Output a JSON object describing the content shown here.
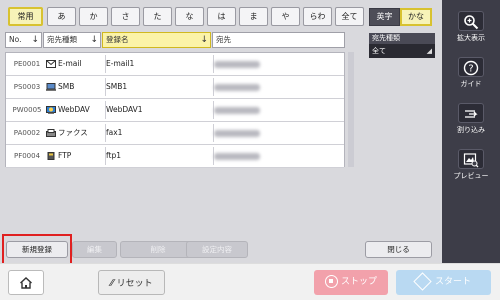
{
  "index_tabs": [
    "常用",
    "あ",
    "か",
    "さ",
    "た",
    "な",
    "は",
    "ま",
    "や",
    "らわ",
    "全て"
  ],
  "char_toggle": {
    "alpha": "英字",
    "kana": "かな"
  },
  "headers": {
    "no": "No.",
    "type": "宛先種類",
    "name": "登録名",
    "dest": "宛先"
  },
  "filter": {
    "label": "宛先種類",
    "value": "全て"
  },
  "rows": [
    {
      "no": "PE0001",
      "type": "E-mail",
      "name": "E-mail1"
    },
    {
      "no": "PS0003",
      "type": "SMB",
      "name": "SMB1"
    },
    {
      "no": "PW0005",
      "type": "WebDAV",
      "name": "WebDAV1"
    },
    {
      "no": "PA0002",
      "type": "ファクス",
      "name": "fax1"
    },
    {
      "no": "PF0004",
      "type": "FTP",
      "name": "ftp1"
    }
  ],
  "buttons": {
    "new": "新規登録",
    "edit": "編集",
    "delete": "削除",
    "settings": "設定内容",
    "close": "閉じる"
  },
  "side": {
    "zoom": "拡大表示",
    "guide": "ガイド",
    "interrupt": "割り込み",
    "preview": "プレビュー"
  },
  "bottom": {
    "reset": "リセット",
    "stop": "ストップ",
    "start": "スタート"
  },
  "colors": {
    "accent_yellow": "#f7f3b8",
    "highlight_red": "#e02020",
    "stop_pink": "#f2a1ab",
    "start_blue": "#b9d9f2"
  }
}
